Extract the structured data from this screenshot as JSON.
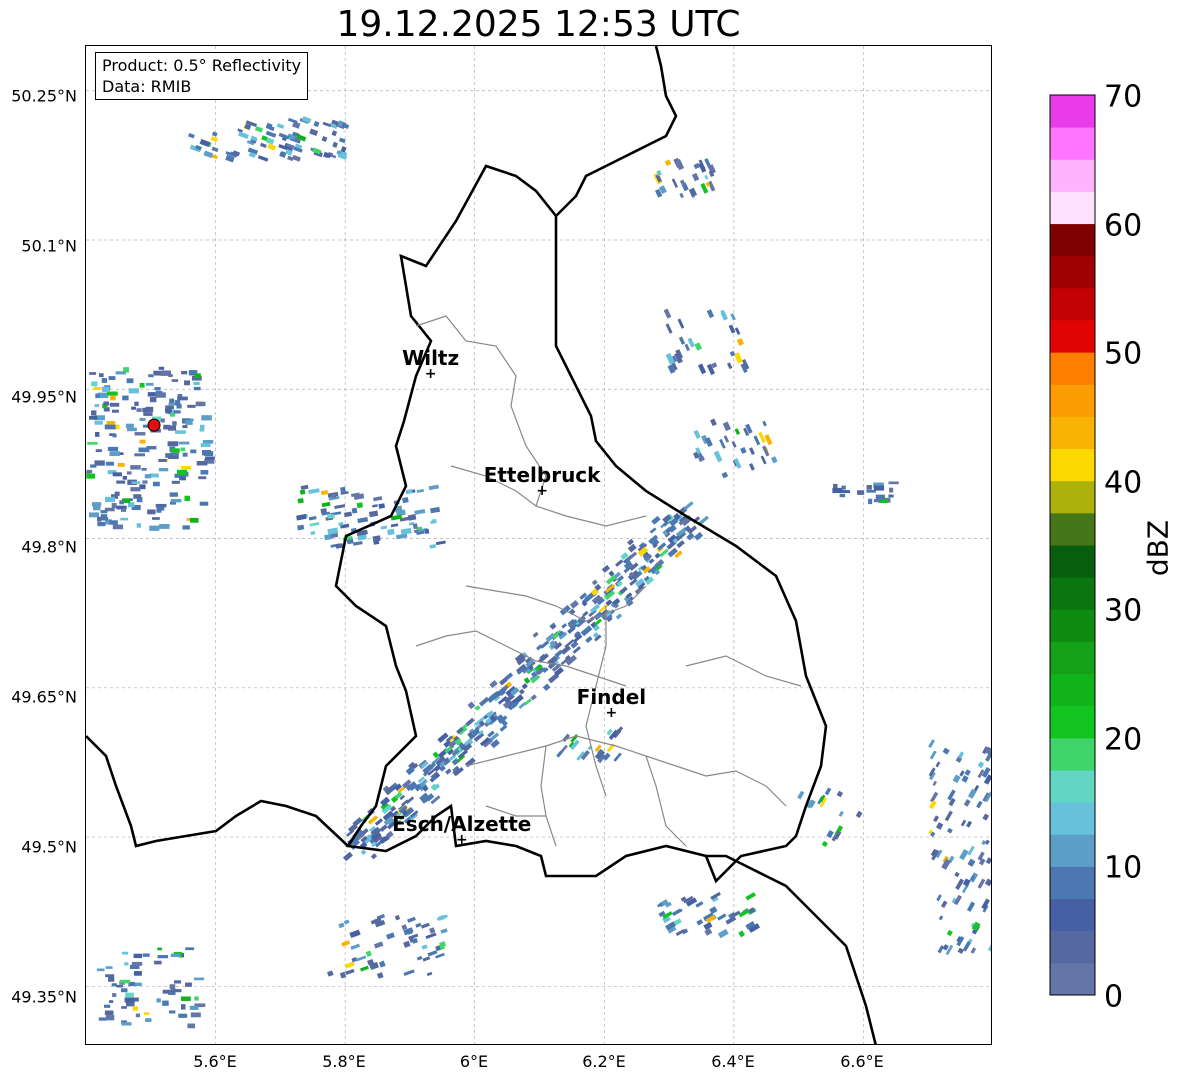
{
  "title": "19.12.2025 12:53 UTC",
  "info_box": {
    "product": "Product: 0.5° Reflectivity",
    "data": "Data: RMIB"
  },
  "map": {
    "lat_range": [
      49.29,
      50.295
    ],
    "lon_range": [
      5.4,
      6.8
    ],
    "y_ticks": [
      "50.25°N",
      "50.1°N",
      "49.95°N",
      "49.8°N",
      "49.65°N",
      "49.5°N",
      "49.35°N"
    ],
    "x_ticks": [
      "5.6°E",
      "5.8°E",
      "6°E",
      "6.2°E",
      "6.4°E",
      "6.6°E"
    ],
    "cities": [
      {
        "name": "Wiltz",
        "lat": 49.965,
        "lon": 5.932
      },
      {
        "name": "Ettelbruck",
        "lat": 49.848,
        "lon": 6.104
      },
      {
        "name": "Findel",
        "lat": 49.625,
        "lon": 6.211
      },
      {
        "name": "Esch/Alzette",
        "lat": 49.497,
        "lon": 5.98
      }
    ],
    "radar_site": {
      "lat": 49.914,
      "lon": 5.505,
      "color": "#e01010"
    },
    "border_color": "#000000",
    "canton_color": "#888888"
  },
  "colorbar": {
    "label": "dBZ",
    "ticks": [
      "70",
      "60",
      "50",
      "40",
      "30",
      "20",
      "10",
      "0"
    ],
    "min": 0,
    "max": 70,
    "colors": [
      "#6475a7",
      "#55689f",
      "#4661a3",
      "#4b78b1",
      "#5c9ec7",
      "#66c1db",
      "#62d6c3",
      "#3fd56b",
      "#12c41f",
      "#11b31a",
      "#13a117",
      "#0f8b12",
      "#0b7510",
      "#095e0d",
      "#457617",
      "#adb10c",
      "#fbd800",
      "#f9b304",
      "#fc9c03",
      "#fc7f00",
      "#e10404",
      "#c30303",
      "#a00202",
      "#7f0000",
      "#ffe0ff",
      "#ffb3ff",
      "#ff75ff",
      "#ea3bea"
    ]
  }
}
